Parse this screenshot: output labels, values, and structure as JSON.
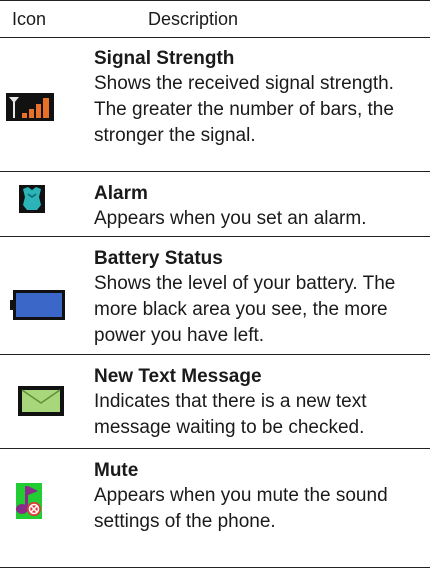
{
  "header": {
    "icon": "Icon",
    "description": "Description"
  },
  "rows": [
    {
      "icon": "signal-strength-icon",
      "title": "Signal Strength",
      "lines": [
        "Shows the received signal strength.",
        "The greater the number of bars, the",
        "stronger the signal."
      ]
    },
    {
      "icon": "alarm-icon",
      "title": "Alarm",
      "lines": [
        "Appears when you set an alarm."
      ]
    },
    {
      "icon": "battery-status-icon",
      "title": "Battery Status",
      "lines": [
        "Shows the level of your battery. The",
        "more black area you see, the more",
        "power you have left."
      ]
    },
    {
      "icon": "new-text-message-icon",
      "title": "New Text Message",
      "lines": [
        "Indicates that there is a new text",
        "message waiting to be checked."
      ]
    },
    {
      "icon": "mute-icon",
      "title": "Mute",
      "lines": [
        "Appears when you mute the sound",
        "settings of the phone."
      ]
    }
  ],
  "colors": {
    "signal_bars": "#e8712a",
    "alarm": "#2bb3b8",
    "battery": "#3a67c8",
    "message": "#a8d67a",
    "mute_bg": "#22cc33",
    "mute_note": "#8a2a8a",
    "mute_badge": "#e03a3a"
  }
}
